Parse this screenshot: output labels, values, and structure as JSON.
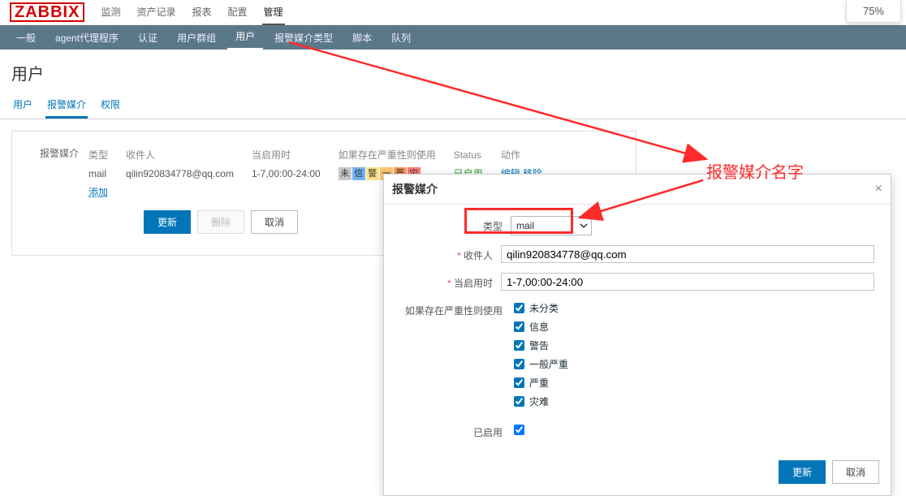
{
  "zoom": "75%",
  "logo": "ZABBIX",
  "topmenu": [
    "监测",
    "资产记录",
    "报表",
    "配置",
    "管理"
  ],
  "topmenu_active": 4,
  "subnav": [
    "一般",
    "agent代理程序",
    "认证",
    "用户群组",
    "用户",
    "报警媒介类型",
    "脚本",
    "队列"
  ],
  "subnav_active": 4,
  "page_title": "用户",
  "tabs": [
    "用户",
    "报警媒介",
    "权限"
  ],
  "tabs_active": 1,
  "media_label": "报警媒介",
  "media_table": {
    "headers": [
      "类型",
      "收件人",
      "当启用时",
      "如果存在严重性则使用",
      "Status",
      "动作"
    ],
    "row": {
      "type": "mail",
      "to": "qilin920834778@qq.com",
      "when": "1-7,00:00-24:00",
      "status": "已启用",
      "act_edit": "编辑",
      "act_del": "移除",
      "sev": [
        "未",
        "信",
        "警",
        "一",
        "严",
        "灾"
      ]
    },
    "add": "添加"
  },
  "buttons": {
    "update": "更新",
    "delete": "删除",
    "cancel": "取消"
  },
  "modal": {
    "title": "报警媒介",
    "type_label": "类型",
    "type_value": "mail",
    "to_label": "收件人",
    "to_value": "qilin920834778@qq.com",
    "when_label": "当启用时",
    "when_value": "1-7,00:00-24:00",
    "sev_label": "如果存在严重性则使用",
    "sev_opts": [
      "未分类",
      "信息",
      "警告",
      "一般严重",
      "严重",
      "灾难"
    ],
    "enabled_label": "已启用",
    "update": "更新",
    "cancel": "取消"
  },
  "annotation": "报警媒介名字"
}
